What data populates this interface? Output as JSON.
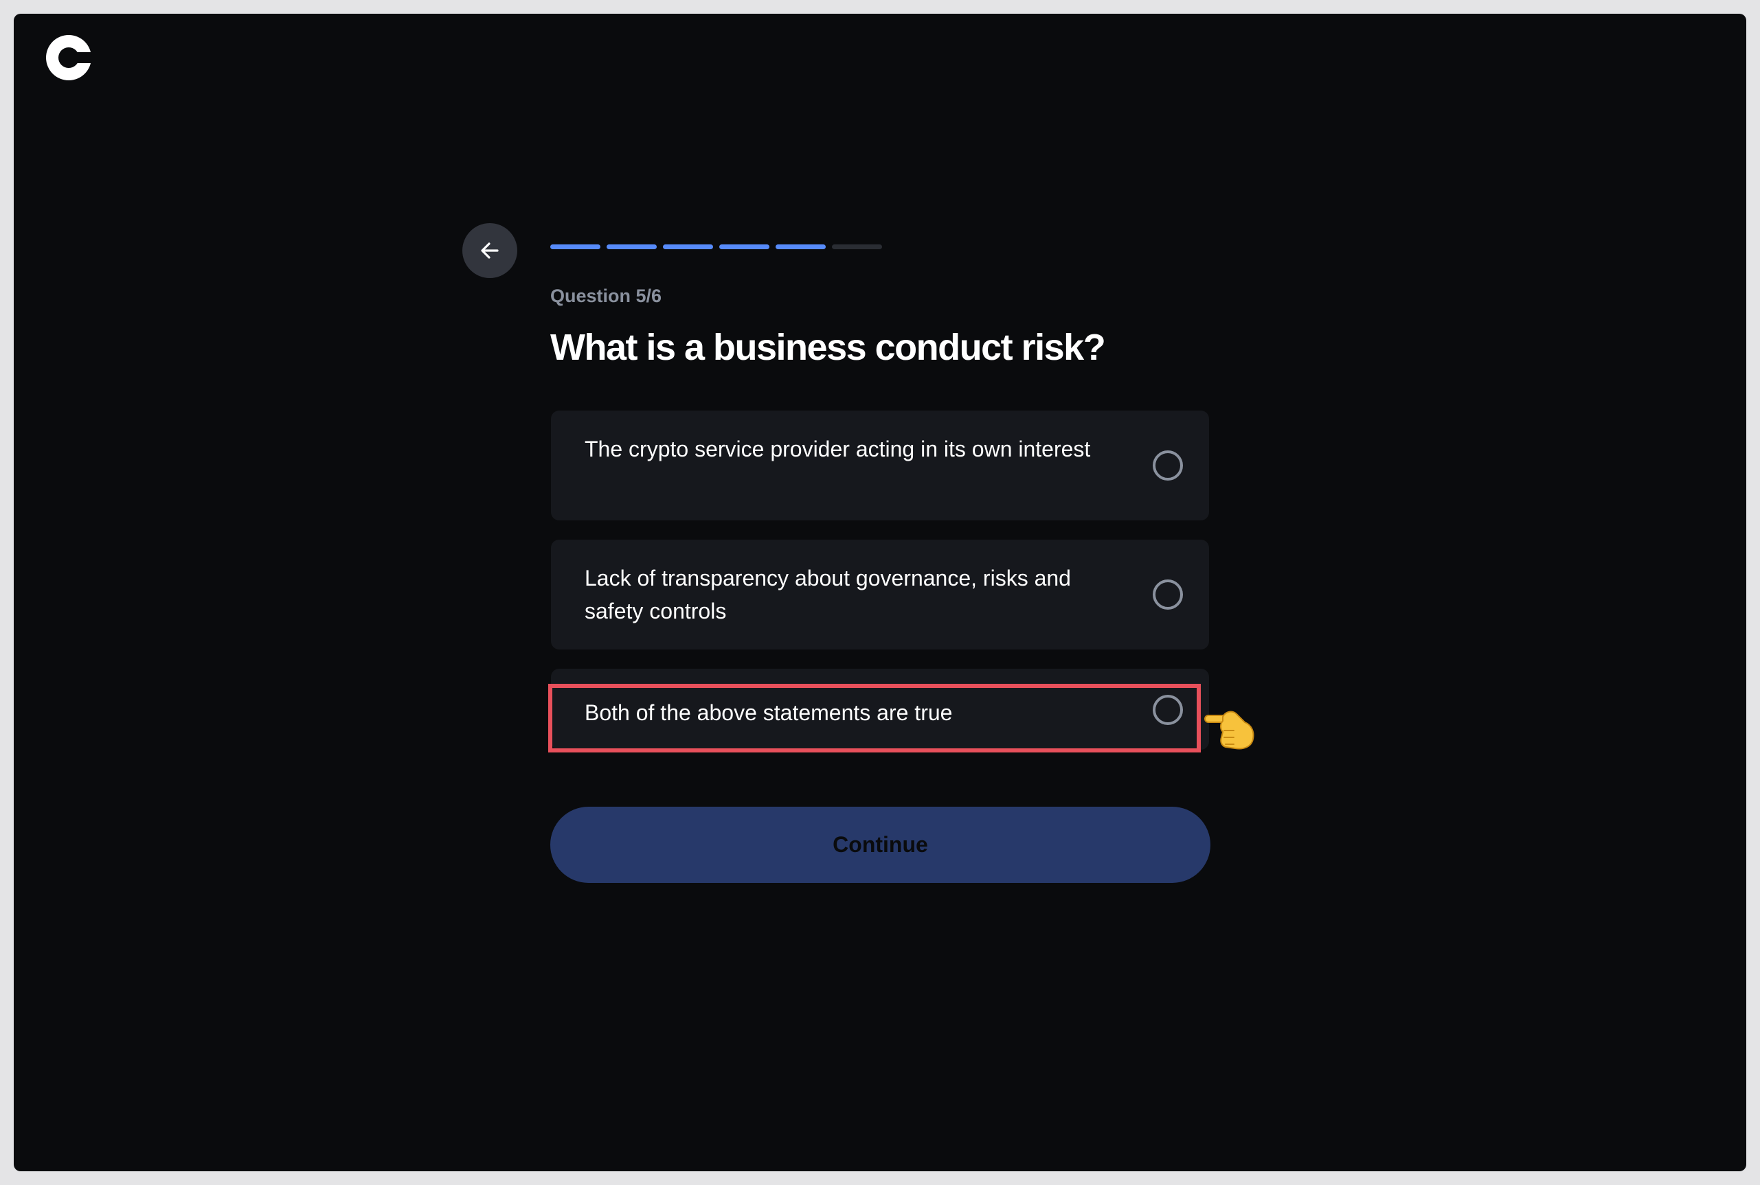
{
  "progress": {
    "total_steps": 6,
    "completed_steps": 5,
    "active_color": "#578bfa",
    "inactive_color": "#2a2d33"
  },
  "question": {
    "counter": "Question 5/6",
    "title": "What is a business conduct risk?"
  },
  "options": [
    {
      "label": "The crypto service provider acting in its own interest",
      "selected": false
    },
    {
      "label": "Lack of transparency about governance, risks and safety controls",
      "selected": false
    },
    {
      "label": "Both of the above statements are true",
      "selected": false
    }
  ],
  "continue_label": "Continue",
  "icons": {
    "logo": "coinbase-logo-icon",
    "back": "arrow-left-icon",
    "radio": "radio-unchecked-icon",
    "pointer": "pointing-hand-icon"
  },
  "colors": {
    "background": "#0a0b0d",
    "card": "#16181d",
    "highlight": "#e8505b",
    "continue_bg": "#27396a"
  }
}
